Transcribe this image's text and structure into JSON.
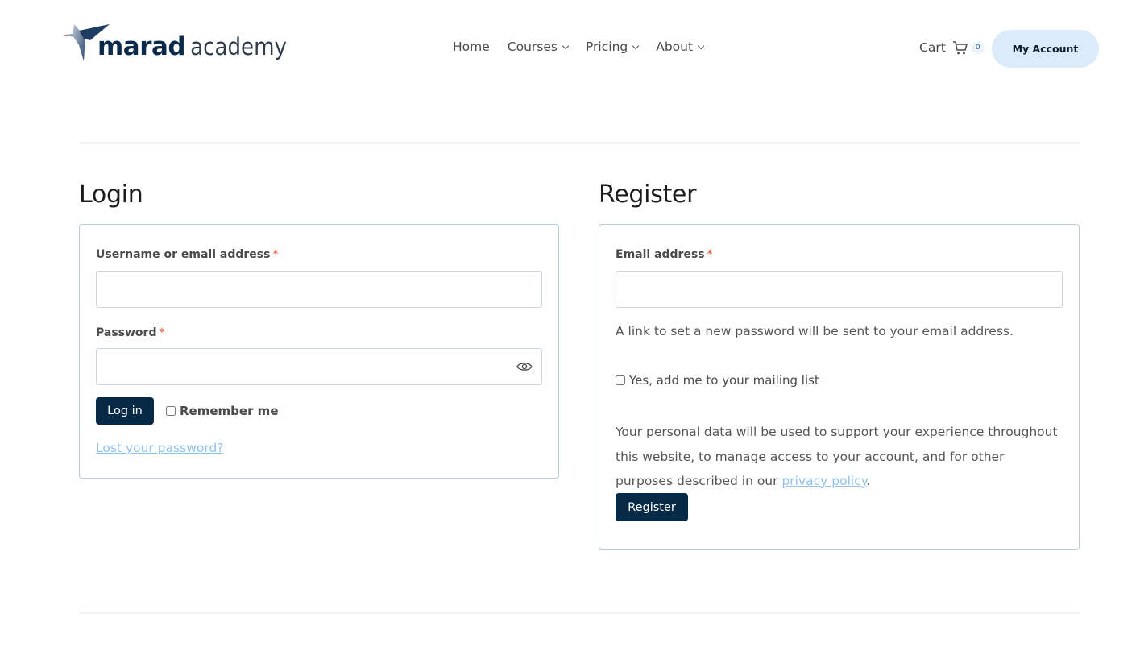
{
  "header": {
    "logo": {
      "brand": "marad",
      "sub": "academy",
      "colors": {
        "navy": "#0b2a4a",
        "accent": "#d8404a"
      }
    },
    "nav": [
      {
        "label": "Home",
        "has_dropdown": false
      },
      {
        "label": "Courses",
        "has_dropdown": true
      },
      {
        "label": "Pricing",
        "has_dropdown": true
      },
      {
        "label": "About",
        "has_dropdown": true
      }
    ],
    "cart": {
      "label": "Cart",
      "icon": "cart-icon",
      "count": "0"
    },
    "account_button": "My Account"
  },
  "login": {
    "title": "Login",
    "username_label": "Username or email address",
    "username_value": "",
    "password_label": "Password",
    "password_value": "",
    "required_marker": "*",
    "show_password_icon": "eye-icon",
    "submit_label": "Log in",
    "remember_label": "Remember me",
    "remember_checked": false,
    "lost_password_link": "Lost your password?"
  },
  "register": {
    "title": "Register",
    "email_label": "Email address",
    "email_value": "",
    "required_marker": "*",
    "password_note": "A link to set a new password will be sent to your email address.",
    "mailing_list_label": "Yes, add me to your mailing list",
    "mailing_list_checked": false,
    "privacy_text_before": "Your personal data will be used to support your experience throughout this website, to manage access to your account, and for other purposes described in our ",
    "privacy_link": "privacy policy",
    "privacy_text_after": ".",
    "submit_label": "Register"
  },
  "colors": {
    "primary_button": "#062a46",
    "account_button_bg": "#dcebf9",
    "link": "#90c2ef",
    "required": "#e2401c",
    "card_border": "#b9ccd8"
  }
}
